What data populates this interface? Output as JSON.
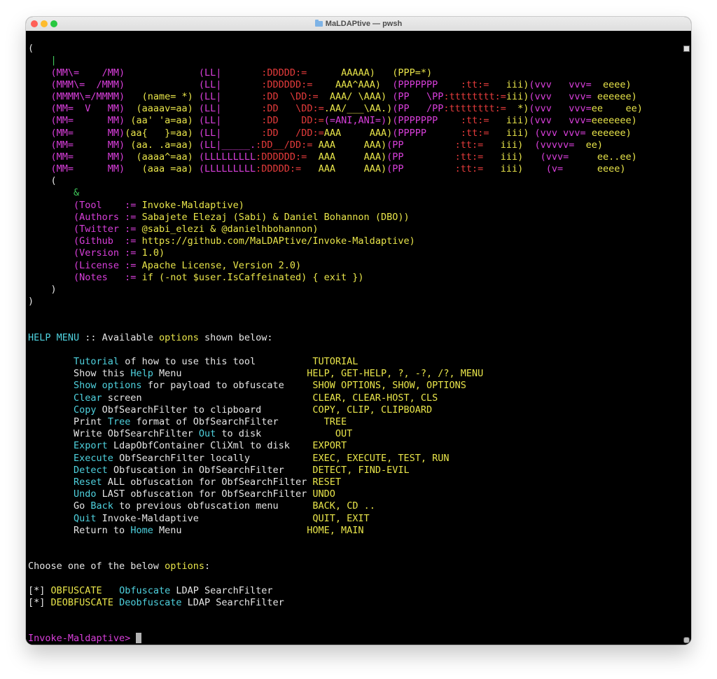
{
  "window": {
    "title": "MaLDAPtive — pwsh"
  },
  "colors": {
    "w": "#e6e6e6",
    "m": "#d93fdb",
    "y": "#e9e54a",
    "r": "#e43b3b",
    "c": "#4fd2df",
    "g": "#3fc75a"
  },
  "terminal": {
    "lines": [
      [
        [
          "",
          "w"
        ]
      ],
      [
        [
          "(",
          "w"
        ]
      ],
      [
        [
          "    ",
          "w"
        ],
        [
          "|",
          "g"
        ]
      ],
      [
        [
          "    ",
          "w"
        ],
        [
          "(MM\\=    /MM)",
          "m"
        ],
        [
          "             ",
          "w"
        ],
        [
          "(LL|",
          "m"
        ],
        [
          "       ",
          "w"
        ],
        [
          ":DDDDD:=",
          "r"
        ],
        [
          "      ",
          "w"
        ],
        [
          "AAAAA)",
          "y"
        ],
        [
          "   ",
          "w"
        ],
        [
          "(PPP=*)",
          "y"
        ]
      ],
      [
        [
          "    ",
          "w"
        ],
        [
          "(MMM\\=  /MMM)",
          "m"
        ],
        [
          "             ",
          "w"
        ],
        [
          "(LL|",
          "m"
        ],
        [
          "       ",
          "w"
        ],
        [
          ":DDDDDD:=",
          "r"
        ],
        [
          "    ",
          "w"
        ],
        [
          "AAA^AAA)",
          "y"
        ],
        [
          "  ",
          "w"
        ],
        [
          "(PPPPPPP",
          "m"
        ],
        [
          "    ",
          "w"
        ],
        [
          ":tt:=",
          "r"
        ],
        [
          "   ",
          "w"
        ],
        [
          "iii)",
          "y"
        ],
        [
          "(vvv   vvv=",
          "m"
        ],
        [
          "  ",
          "w"
        ],
        [
          "eeee)",
          "y"
        ]
      ],
      [
        [
          "    ",
          "w"
        ],
        [
          "(MMMM\\=/MMMM)",
          "m"
        ],
        [
          "   ",
          "w"
        ],
        [
          "(name= *)",
          "y"
        ],
        [
          " ",
          "w"
        ],
        [
          "(LL|",
          "m"
        ],
        [
          "       ",
          "w"
        ],
        [
          ":DD",
          "r"
        ],
        [
          "  ",
          "w"
        ],
        [
          "\\DD:=",
          "r"
        ],
        [
          "  ",
          "w"
        ],
        [
          "AAA/ \\AAA)",
          "y"
        ],
        [
          " ",
          "w"
        ],
        [
          "(PP   \\PP",
          "m"
        ],
        [
          ":tttttttt:=",
          "r"
        ],
        [
          "iii)",
          "y"
        ],
        [
          "(vvv   vvv=",
          "m"
        ],
        [
          " ",
          "w"
        ],
        [
          "eeeeee)",
          "y"
        ]
      ],
      [
        [
          "    ",
          "w"
        ],
        [
          "(MM=  V   MM)",
          "m"
        ],
        [
          "  ",
          "w"
        ],
        [
          "(aaaav=aa)",
          "y"
        ],
        [
          " ",
          "w"
        ],
        [
          "(LL|",
          "m"
        ],
        [
          "       ",
          "w"
        ],
        [
          ":DD",
          "r"
        ],
        [
          "   ",
          "w"
        ],
        [
          "\\DD:=",
          "r"
        ],
        [
          ".AA/___\\AA.)",
          "y"
        ],
        [
          "(PP   /PP",
          "m"
        ],
        [
          ":tttttttt:=",
          "r"
        ],
        [
          "  *)",
          "y"
        ],
        [
          "(vvv   vvv=",
          "m"
        ],
        [
          "ee    ee)",
          "y"
        ]
      ],
      [
        [
          "    ",
          "w"
        ],
        [
          "(MM=      MM)",
          "m"
        ],
        [
          " ",
          "w"
        ],
        [
          "(aa' 'a=aa)",
          "y"
        ],
        [
          " ",
          "w"
        ],
        [
          "(LL|",
          "m"
        ],
        [
          "       ",
          "w"
        ],
        [
          ":DD",
          "r"
        ],
        [
          "    ",
          "w"
        ],
        [
          "DD:=",
          "r"
        ],
        [
          "(=ANI,ANI=)",
          "m"
        ],
        [
          ")",
          "y"
        ],
        [
          "(PPPPPPP",
          "m"
        ],
        [
          "    ",
          "w"
        ],
        [
          ":tt:=",
          "r"
        ],
        [
          "   ",
          "w"
        ],
        [
          "iii)",
          "y"
        ],
        [
          "(vvv   vvv=",
          "m"
        ],
        [
          "eeeeeee)",
          "y"
        ]
      ],
      [
        [
          "    ",
          "w"
        ],
        [
          "(MM=      MM)",
          "m"
        ],
        [
          "(aa{   }=aa)",
          "y"
        ],
        [
          " ",
          "w"
        ],
        [
          "(LL|",
          "m"
        ],
        [
          "       ",
          "w"
        ],
        [
          ":DD",
          "r"
        ],
        [
          "   ",
          "w"
        ],
        [
          "/DD:=",
          "r"
        ],
        [
          "AAA     AAA)",
          "y"
        ],
        [
          "(PPPPP",
          "m"
        ],
        [
          "      ",
          "w"
        ],
        [
          ":tt:=",
          "r"
        ],
        [
          "   ",
          "w"
        ],
        [
          "iii)",
          "y"
        ],
        [
          " ",
          "w"
        ],
        [
          "(vvv vvv=",
          "m"
        ],
        [
          " ",
          "w"
        ],
        [
          "eeeeee)",
          "y"
        ]
      ],
      [
        [
          "    ",
          "w"
        ],
        [
          "(MM=      MM)",
          "m"
        ],
        [
          " ",
          "w"
        ],
        [
          "(aa. .a=aa)",
          "y"
        ],
        [
          " ",
          "w"
        ],
        [
          "(LL|_____.",
          "m"
        ],
        [
          ":DD__/DD:=",
          "r"
        ],
        [
          " ",
          "w"
        ],
        [
          "AAA     AAA)",
          "y"
        ],
        [
          "(PP",
          "m"
        ],
        [
          "         ",
          "w"
        ],
        [
          ":tt:=",
          "r"
        ],
        [
          "   ",
          "w"
        ],
        [
          "iii)",
          "y"
        ],
        [
          "  ",
          "w"
        ],
        [
          "(vvvvv=",
          "m"
        ],
        [
          "  ",
          "w"
        ],
        [
          "ee)",
          "y"
        ]
      ],
      [
        [
          "    ",
          "w"
        ],
        [
          "(MM=      MM)",
          "m"
        ],
        [
          "  ",
          "w"
        ],
        [
          "(aaaa^=aa)",
          "y"
        ],
        [
          " ",
          "w"
        ],
        [
          "(LLLLLLLLL",
          "m"
        ],
        [
          ":DDDDDD:=",
          "r"
        ],
        [
          "  ",
          "w"
        ],
        [
          "AAA     AAA)",
          "y"
        ],
        [
          "(PP",
          "m"
        ],
        [
          "         ",
          "w"
        ],
        [
          ":tt:=",
          "r"
        ],
        [
          "   ",
          "w"
        ],
        [
          "iii)",
          "y"
        ],
        [
          "   ",
          "w"
        ],
        [
          "(vvv=",
          "m"
        ],
        [
          "     ",
          "w"
        ],
        [
          "ee..ee)",
          "y"
        ]
      ],
      [
        [
          "    ",
          "w"
        ],
        [
          "(MM=      MM)",
          "m"
        ],
        [
          "   ",
          "w"
        ],
        [
          "(aaa =aa)",
          "y"
        ],
        [
          " ",
          "w"
        ],
        [
          "(LLLLLLLLL",
          "m"
        ],
        [
          ":DDDDD:=",
          "r"
        ],
        [
          "   ",
          "w"
        ],
        [
          "AAA     AAA)",
          "y"
        ],
        [
          "(PP",
          "m"
        ],
        [
          "         ",
          "w"
        ],
        [
          ":tt:=",
          "r"
        ],
        [
          "   ",
          "w"
        ],
        [
          "iii)",
          "y"
        ],
        [
          "    ",
          "w"
        ],
        [
          "(v=",
          "m"
        ],
        [
          "      ",
          "w"
        ],
        [
          "eeee)",
          "y"
        ]
      ],
      [
        [
          "    ",
          "w"
        ],
        [
          "(",
          "w"
        ]
      ],
      [
        [
          "        ",
          "w"
        ],
        [
          "&",
          "g"
        ]
      ],
      [
        [
          "        ",
          "w"
        ],
        [
          "(Tool    := ",
          "m"
        ],
        [
          "Invoke-Maldaptive)",
          "y"
        ]
      ],
      [
        [
          "        ",
          "w"
        ],
        [
          "(Authors := ",
          "m"
        ],
        [
          "Sabajete Elezaj (Sabi) & Daniel Bohannon (DBO))",
          "y"
        ]
      ],
      [
        [
          "        ",
          "w"
        ],
        [
          "(Twitter := ",
          "m"
        ],
        [
          "@sabi_elezi & @danielhbohannon)",
          "y"
        ]
      ],
      [
        [
          "        ",
          "w"
        ],
        [
          "(Github  := ",
          "m"
        ],
        [
          "https://github.com/MaLDAPtive/Invoke-Maldaptive)",
          "y"
        ]
      ],
      [
        [
          "        ",
          "w"
        ],
        [
          "(Version := ",
          "m"
        ],
        [
          "1.0)",
          "y"
        ]
      ],
      [
        [
          "        ",
          "w"
        ],
        [
          "(License := ",
          "m"
        ],
        [
          "Apache License, Version 2.0)",
          "y"
        ]
      ],
      [
        [
          "        ",
          "w"
        ],
        [
          "(Notes   := ",
          "m"
        ],
        [
          "if (-not $user.IsCaffeinated) { exit })",
          "y"
        ]
      ],
      [
        [
          "    ",
          "w"
        ],
        [
          ")",
          "w"
        ]
      ],
      [
        [
          ")",
          "w"
        ]
      ],
      [
        [
          "",
          "w"
        ]
      ],
      [
        [
          "",
          "w"
        ]
      ],
      [
        [
          "HELP MENU",
          "c"
        ],
        [
          " :: Available ",
          "w"
        ],
        [
          "options",
          "y"
        ],
        [
          " shown below:",
          "w"
        ]
      ],
      [
        [
          "",
          "w"
        ]
      ],
      [
        [
          "        ",
          "w"
        ],
        [
          "Tutorial",
          "c"
        ],
        [
          " of how to use this tool          ",
          "w"
        ],
        [
          "TUTORIAL",
          "y"
        ]
      ],
      [
        [
          "        ",
          "w"
        ],
        [
          "Show this ",
          "w"
        ],
        [
          "Help",
          "c"
        ],
        [
          " Menu                      ",
          "w"
        ],
        [
          "HELP, GET-HELP, ?, -?, /?, MENU",
          "y"
        ]
      ],
      [
        [
          "        ",
          "w"
        ],
        [
          "Show options",
          "c"
        ],
        [
          " for payload to obfuscate     ",
          "w"
        ],
        [
          "SHOW OPTIONS, SHOW, OPTIONS",
          "y"
        ]
      ],
      [
        [
          "        ",
          "w"
        ],
        [
          "Clear",
          "c"
        ],
        [
          " screen                              ",
          "w"
        ],
        [
          "CLEAR, CLEAR-HOST, CLS",
          "y"
        ]
      ],
      [
        [
          "        ",
          "w"
        ],
        [
          "Copy",
          "c"
        ],
        [
          " ObfSearchFilter to clipboard         ",
          "w"
        ],
        [
          "COPY, CLIP, CLIPBOARD",
          "y"
        ]
      ],
      [
        [
          "        ",
          "w"
        ],
        [
          "Print ",
          "w"
        ],
        [
          "Tree",
          "c"
        ],
        [
          " format of ObfSearchFilter        ",
          "w"
        ],
        [
          "TREE",
          "y"
        ]
      ],
      [
        [
          "        ",
          "w"
        ],
        [
          "Write ObfSearchFilter ",
          "w"
        ],
        [
          "Out",
          "c"
        ],
        [
          " to disk             ",
          "w"
        ],
        [
          "OUT",
          "y"
        ]
      ],
      [
        [
          "        ",
          "w"
        ],
        [
          "Export",
          "c"
        ],
        [
          " LdapObfContainer CliXml to disk    ",
          "w"
        ],
        [
          "EXPORT",
          "y"
        ]
      ],
      [
        [
          "        ",
          "w"
        ],
        [
          "Execute",
          "c"
        ],
        [
          " ObfSearchFilter locally           ",
          "w"
        ],
        [
          "EXEC, EXECUTE, TEST, RUN",
          "y"
        ]
      ],
      [
        [
          "        ",
          "w"
        ],
        [
          "Detect",
          "c"
        ],
        [
          " Obfuscation in ObfSearchFilter     ",
          "w"
        ],
        [
          "DETECT, FIND-EVIL",
          "y"
        ]
      ],
      [
        [
          "        ",
          "w"
        ],
        [
          "Reset",
          "c"
        ],
        [
          " ALL obfuscation for ObfSearchFilter ",
          "w"
        ],
        [
          "RESET",
          "y"
        ]
      ],
      [
        [
          "        ",
          "w"
        ],
        [
          "Undo",
          "c"
        ],
        [
          " LAST obfuscation for ObfSearchFilter ",
          "w"
        ],
        [
          "UNDO",
          "y"
        ]
      ],
      [
        [
          "        ",
          "w"
        ],
        [
          "Go ",
          "w"
        ],
        [
          "Back",
          "c"
        ],
        [
          " to previous obfuscation menu      ",
          "w"
        ],
        [
          "BACK, CD ..",
          "y"
        ]
      ],
      [
        [
          "        ",
          "w"
        ],
        [
          "Quit",
          "c"
        ],
        [
          " Invoke-Maldaptive                    ",
          "w"
        ],
        [
          "QUIT, EXIT",
          "y"
        ]
      ],
      [
        [
          "        ",
          "w"
        ],
        [
          "Return to ",
          "w"
        ],
        [
          "Home",
          "c"
        ],
        [
          " Menu                      ",
          "w"
        ],
        [
          "HOME, MAIN",
          "y"
        ]
      ],
      [
        [
          "",
          "w"
        ]
      ],
      [
        [
          "",
          "w"
        ]
      ],
      [
        [
          "Choose one of the below ",
          "w"
        ],
        [
          "options",
          "y"
        ],
        [
          ":",
          "w"
        ]
      ],
      [
        [
          "",
          "w"
        ]
      ],
      [
        [
          "[*] ",
          "w"
        ],
        [
          "OBFUSCATE",
          "y"
        ],
        [
          "   ",
          "w"
        ],
        [
          "Obfuscate",
          "c"
        ],
        [
          " LDAP SearchFilter",
          "w"
        ]
      ],
      [
        [
          "[*] ",
          "w"
        ],
        [
          "DEOBFUSCATE",
          "y"
        ],
        [
          " ",
          "w"
        ],
        [
          "Deobfuscate",
          "c"
        ],
        [
          " LDAP SearchFilter",
          "w"
        ]
      ],
      [
        [
          "",
          "w"
        ]
      ],
      [
        [
          "",
          "w"
        ]
      ]
    ],
    "prompt": "Invoke-Maldaptive> "
  }
}
